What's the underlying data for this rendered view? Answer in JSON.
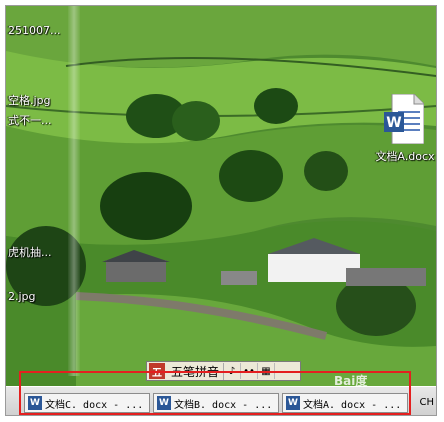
{
  "desktop": {
    "left_labels": [
      "251007...",
      "空格.jpg",
      "式不一...",
      "虎机抽...",
      "2.jpg"
    ],
    "doc_icon": {
      "name": "word-doc-icon",
      "label": "文档A.docx",
      "badge": "W"
    }
  },
  "ime": {
    "logo": "五",
    "name": "五笔拼音",
    "buttons": [
      "♪",
      "••",
      "▦"
    ]
  },
  "taskbar": {
    "items": [
      {
        "label": "文档C. docx - ...",
        "icon": "W"
      },
      {
        "label": "文档B. docx - ...",
        "icon": "W"
      },
      {
        "label": "文档A. docx - ...",
        "icon": "W"
      }
    ],
    "lang": "CH"
  },
  "watermark": "Bai度"
}
